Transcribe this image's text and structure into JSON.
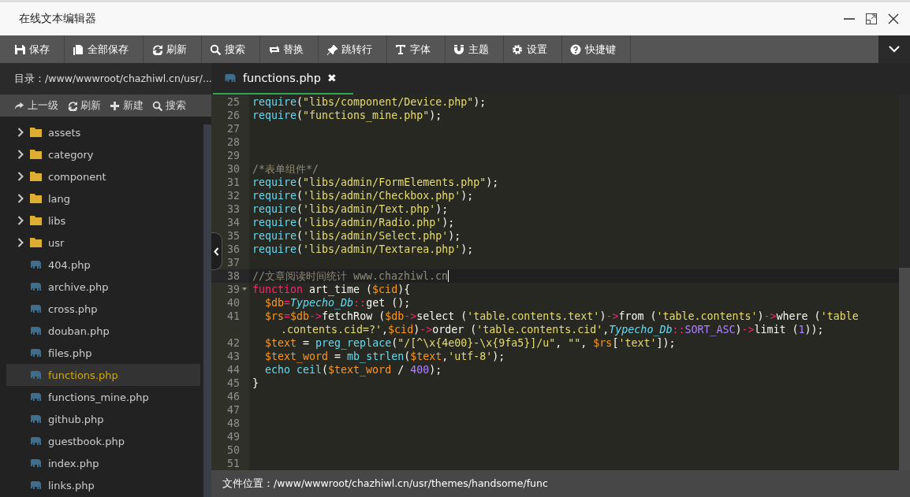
{
  "window": {
    "title": "在线文本编辑器"
  },
  "toolbar": [
    "保存",
    "全部保存",
    "刷新",
    "搜索",
    "替换",
    "跳转行",
    "字体",
    "主题",
    "设置",
    "快捷键"
  ],
  "sidebar": {
    "path": "目录：/www/wwwroot/chazhiwl.cn/usr/...",
    "tools": [
      "上一级",
      "刷新",
      "新建",
      "搜索"
    ],
    "items": [
      {
        "kind": "folder",
        "name": "assets",
        "selected": false
      },
      {
        "kind": "folder",
        "name": "category",
        "selected": false
      },
      {
        "kind": "folder",
        "name": "component",
        "selected": false
      },
      {
        "kind": "folder",
        "name": "lang",
        "selected": false
      },
      {
        "kind": "folder",
        "name": "libs",
        "selected": false
      },
      {
        "kind": "folder",
        "name": "usr",
        "selected": false
      },
      {
        "kind": "file",
        "name": "404.php",
        "selected": false
      },
      {
        "kind": "file",
        "name": "archive.php",
        "selected": false
      },
      {
        "kind": "file",
        "name": "cross.php",
        "selected": false
      },
      {
        "kind": "file",
        "name": "douban.php",
        "selected": false
      },
      {
        "kind": "file",
        "name": "files.php",
        "selected": false
      },
      {
        "kind": "file",
        "name": "functions.php",
        "selected": true
      },
      {
        "kind": "file",
        "name": "functions_mine.php",
        "selected": false
      },
      {
        "kind": "file",
        "name": "github.php",
        "selected": false
      },
      {
        "kind": "file",
        "name": "guestbook.php",
        "selected": false
      },
      {
        "kind": "file",
        "name": "index.php",
        "selected": false
      },
      {
        "kind": "file",
        "name": "links.php",
        "selected": false
      }
    ]
  },
  "tabs": [
    {
      "label": "functions.php",
      "selected": true,
      "close": "✖"
    }
  ],
  "editor": {
    "lines": [
      {
        "number": "25",
        "active": false,
        "fold": false,
        "tokens": [
          {
            "kind": "call",
            "text": "require"
          },
          {
            "kind": "plain",
            "text": "("
          },
          {
            "kind": "string",
            "text": "\"libs/component/Device.php\""
          },
          {
            "kind": "plain",
            "text": ");"
          }
        ]
      },
      {
        "number": "26",
        "active": false,
        "fold": false,
        "tokens": [
          {
            "kind": "call",
            "text": "require"
          },
          {
            "kind": "plain",
            "text": "("
          },
          {
            "kind": "string",
            "text": "\"functions_mine.php\""
          },
          {
            "kind": "plain",
            "text": ");"
          }
        ]
      },
      {
        "number": "27",
        "active": false,
        "fold": false
      },
      {
        "number": "28",
        "active": false,
        "fold": false
      },
      {
        "number": "29",
        "active": false,
        "fold": false
      },
      {
        "number": "30",
        "active": false,
        "fold": false,
        "tokens": [
          {
            "kind": "comment",
            "text": "/*表单组件*/"
          }
        ]
      },
      {
        "number": "31",
        "active": false,
        "fold": false,
        "tokens": [
          {
            "kind": "call",
            "text": "require"
          },
          {
            "kind": "plain",
            "text": "("
          },
          {
            "kind": "string",
            "text": "\"libs/admin/FormElements.php\""
          },
          {
            "kind": "plain",
            "text": ");"
          }
        ]
      },
      {
        "number": "32",
        "active": false,
        "fold": false,
        "tokens": [
          {
            "kind": "call",
            "text": "require"
          },
          {
            "kind": "plain",
            "text": "("
          },
          {
            "kind": "string",
            "text": "'libs/admin/Checkbox.php'"
          },
          {
            "kind": "plain",
            "text": ");"
          }
        ]
      },
      {
        "number": "33",
        "active": false,
        "fold": false,
        "tokens": [
          {
            "kind": "call",
            "text": "require"
          },
          {
            "kind": "plain",
            "text": "("
          },
          {
            "kind": "string",
            "text": "'libs/admin/Text.php'"
          },
          {
            "kind": "plain",
            "text": ");"
          }
        ]
      },
      {
        "number": "34",
        "active": false,
        "fold": false,
        "tokens": [
          {
            "kind": "call",
            "text": "require"
          },
          {
            "kind": "plain",
            "text": "("
          },
          {
            "kind": "string",
            "text": "'libs/admin/Radio.php'"
          },
          {
            "kind": "plain",
            "text": ");"
          }
        ]
      },
      {
        "number": "35",
        "active": false,
        "fold": false,
        "tokens": [
          {
            "kind": "call",
            "text": "require"
          },
          {
            "kind": "plain",
            "text": "("
          },
          {
            "kind": "string",
            "text": "'libs/admin/Select.php'"
          },
          {
            "kind": "plain",
            "text": ");"
          }
        ]
      },
      {
        "number": "36",
        "active": false,
        "fold": false,
        "tokens": [
          {
            "kind": "call",
            "text": "require"
          },
          {
            "kind": "plain",
            "text": "("
          },
          {
            "kind": "string",
            "text": "'libs/admin/Textarea.php'"
          },
          {
            "kind": "plain",
            "text": ");"
          }
        ]
      },
      {
        "number": "37",
        "active": false,
        "fold": false
      },
      {
        "number": "38",
        "active": true,
        "fold": false,
        "tokens": [
          {
            "kind": "comment",
            "text": "//文章阅读时间统计 www.chazhiwl.cn"
          }
        ]
      },
      {
        "number": "39",
        "active": false,
        "fold": true,
        "tokens": [
          {
            "kind": "keyword",
            "text": "function"
          },
          {
            "kind": "plain",
            "text": " art_time ("
          },
          {
            "kind": "variable",
            "text": "$cid"
          },
          {
            "kind": "plain",
            "text": "){"
          }
        ]
      },
      {
        "number": "40",
        "active": false,
        "fold": false,
        "tokens": [
          {
            "kind": "variable",
            "text": "  $db"
          },
          {
            "kind": "keyword",
            "text": "="
          },
          {
            "kind": "type",
            "text": "Typecho_Db"
          },
          {
            "kind": "keyword",
            "text": "::"
          },
          {
            "kind": "plain",
            "text": "get ();"
          }
        ]
      },
      {
        "number": "41",
        "active": false,
        "fold": false,
        "tokens": [
          {
            "kind": "variable",
            "text": "  $rs"
          },
          {
            "kind": "keyword",
            "text": "="
          },
          {
            "kind": "variable",
            "text": "$db"
          },
          {
            "kind": "keyword",
            "text": "->"
          },
          {
            "kind": "plain",
            "text": "fetchRow ("
          },
          {
            "kind": "variable",
            "text": "$db"
          },
          {
            "kind": "keyword",
            "text": "->"
          },
          {
            "kind": "plain",
            "text": "select ("
          },
          {
            "kind": "string",
            "text": "'table.contents.text'"
          },
          {
            "kind": "plain",
            "text": ")"
          },
          {
            "kind": "keyword",
            "text": "->"
          },
          {
            "kind": "plain",
            "text": "from ("
          },
          {
            "kind": "string",
            "text": "'table.contents'"
          },
          {
            "kind": "plain",
            "text": ")"
          },
          {
            "kind": "keyword",
            "text": "->"
          },
          {
            "kind": "plain",
            "text": "where ("
          },
          {
            "kind": "string",
            "text": "'table"
          }
        ],
        "wrap": [
          {
            "kind": "string",
            "text": ".contents.cid=?'"
          },
          {
            "kind": "plain",
            "text": ","
          },
          {
            "kind": "variable",
            "text": "$cid"
          },
          {
            "kind": "plain",
            "text": ")"
          },
          {
            "kind": "keyword",
            "text": "->"
          },
          {
            "kind": "plain",
            "text": "order ("
          },
          {
            "kind": "string",
            "text": "'table.contents.cid'"
          },
          {
            "kind": "plain",
            "text": ","
          },
          {
            "kind": "type",
            "text": "Typecho_Db"
          },
          {
            "kind": "keyword",
            "text": "::"
          },
          {
            "kind": "constant",
            "text": "SORT_ASC"
          },
          {
            "kind": "plain",
            "text": ")"
          },
          {
            "kind": "keyword",
            "text": "->"
          },
          {
            "kind": "plain",
            "text": "limit ("
          },
          {
            "kind": "constant",
            "text": "1"
          },
          {
            "kind": "plain",
            "text": "));"
          }
        ]
      },
      {
        "number": "42",
        "active": false,
        "fold": false,
        "tokens": [
          {
            "kind": "variable",
            "text": "  $text"
          },
          {
            "kind": "plain",
            "text": " = "
          },
          {
            "kind": "call",
            "text": "preg_replace"
          },
          {
            "kind": "plain",
            "text": "("
          },
          {
            "kind": "string",
            "text": "\"/[^\\x{4e00}-\\x{9fa5}]/u\""
          },
          {
            "kind": "plain",
            "text": ", "
          },
          {
            "kind": "string",
            "text": "\"\""
          },
          {
            "kind": "plain",
            "text": ", "
          },
          {
            "kind": "variable",
            "text": "$rs"
          },
          {
            "kind": "plain",
            "text": "["
          },
          {
            "kind": "string",
            "text": "'text'"
          },
          {
            "kind": "plain",
            "text": "]);"
          }
        ]
      },
      {
        "number": "43",
        "active": false,
        "fold": false,
        "tokens": [
          {
            "kind": "variable",
            "text": "  $text_word"
          },
          {
            "kind": "plain",
            "text": " = "
          },
          {
            "kind": "call",
            "text": "mb_strlen"
          },
          {
            "kind": "plain",
            "text": "("
          },
          {
            "kind": "variable",
            "text": "$text"
          },
          {
            "kind": "plain",
            "text": ","
          },
          {
            "kind": "string",
            "text": "'utf-8'"
          },
          {
            "kind": "plain",
            "text": ");"
          }
        ]
      },
      {
        "number": "44",
        "active": false,
        "fold": false,
        "tokens": [
          {
            "kind": "call",
            "text": "  echo ceil"
          },
          {
            "kind": "plain",
            "text": "("
          },
          {
            "kind": "variable",
            "text": "$text_word"
          },
          {
            "kind": "plain",
            "text": " / "
          },
          {
            "kind": "constant",
            "text": "400"
          },
          {
            "kind": "plain",
            "text": ");"
          }
        ]
      },
      {
        "number": "45",
        "active": false,
        "fold": false,
        "tokens": [
          {
            "kind": "plain",
            "text": "}"
          }
        ]
      },
      {
        "number": "46",
        "active": false,
        "fold": false
      },
      {
        "number": "47",
        "active": false,
        "fold": false
      },
      {
        "number": "48",
        "active": false,
        "fold": false
      },
      {
        "number": "49",
        "active": false,
        "fold": false
      },
      {
        "number": "50",
        "active": false,
        "fold": false
      },
      {
        "number": "51",
        "active": false,
        "fold": false
      }
    ]
  },
  "status_bar": "文件位置：/www/wwwroot/chazhiwl.cn/usr/themes/handsome/func"
}
